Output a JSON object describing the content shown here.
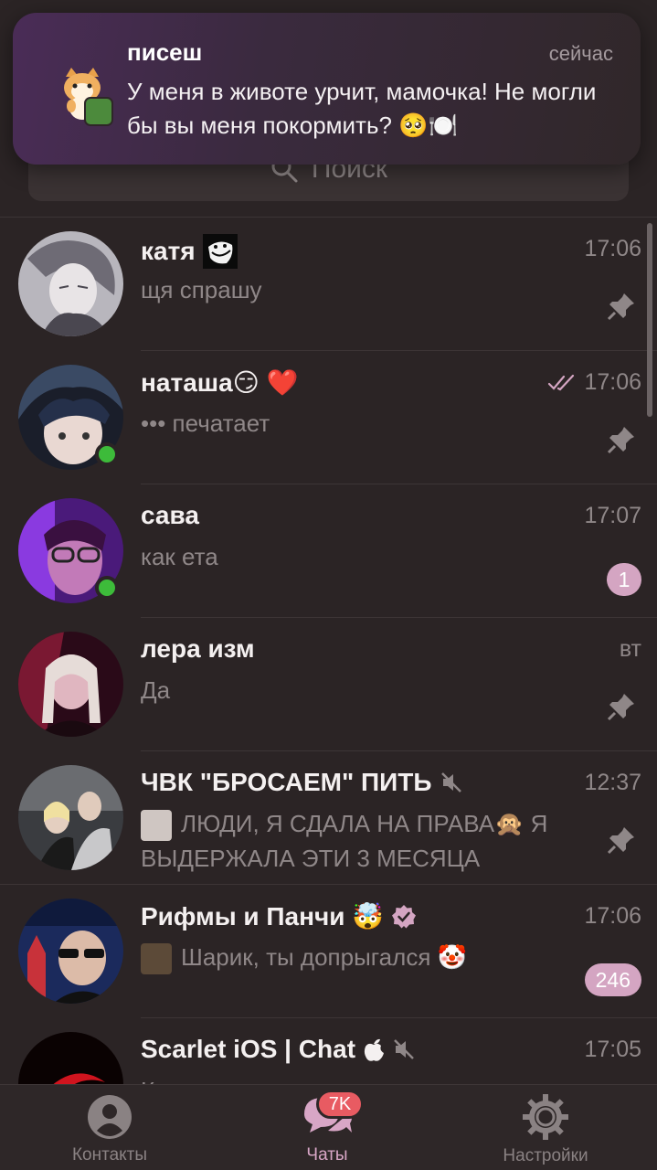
{
  "search": {
    "placeholder": "Поиск"
  },
  "notification": {
    "sender": "писеш",
    "time": "сейчас",
    "text": "У меня в животе урчит, мамочка! Не могли бы вы меня покормить? 🥺🍽️",
    "avatar_icon": "cat-sticker-icon"
  },
  "chats": [
    {
      "title": "катя",
      "title_icon": "troll-face-icon",
      "time": "17:06",
      "preview": "щя спрашу",
      "pinned": true,
      "online": false,
      "avatar_color": "#9a9aa0"
    },
    {
      "title": "наташа😏 ❤️",
      "time": "17:06",
      "read_icon": "double-check-icon",
      "preview": "••• печатает",
      "pinned": true,
      "online": true,
      "avatar_color": "#4a5a70"
    },
    {
      "title": "сава",
      "time": "17:07",
      "preview": "как ета",
      "unread": "1",
      "online": true,
      "avatar_color": "#7a2fa8"
    },
    {
      "title": "лера изм",
      "time": "вт",
      "preview": "Да",
      "pinned": true,
      "online": false,
      "avatar_color": "#8a2b4a"
    },
    {
      "title": "ЧВК \"БРОСАЕМ\" ПИТЬ",
      "muted": true,
      "time": "12:37",
      "preview": "ЛЮДИ, Я СДАЛА НА ПРАВА🙊 Я ВЫДЕРЖАЛА ЭТИ 3 МЕСЯЦА",
      "pinned": true,
      "avatar_color": "#55575a"
    },
    {
      "title": "Рифмы и Панчи 🤯",
      "verified": true,
      "time": "17:06",
      "preview": "Шарик, ты допрыгался 🤡",
      "unread": "246",
      "avatar_color": "#2a3c78"
    },
    {
      "title": "Scarlet iOS | Chat ",
      "muted": true,
      "time": "17:05",
      "preview": "Кипька под ослами",
      "avatar_color": "#8a0f14"
    }
  ],
  "tabs": [
    {
      "label": "Контакты",
      "icon": "person-icon"
    },
    {
      "label": "Чаты",
      "icon": "chat-bubbles-icon",
      "badge": "7K",
      "active": true
    },
    {
      "label": "Настройки",
      "icon": "gear-icon"
    }
  ],
  "colors": {
    "accent": "#d4a5c2",
    "online": "#3dbb3a",
    "badge_red": "#e85b62",
    "background": "#2b2425"
  }
}
